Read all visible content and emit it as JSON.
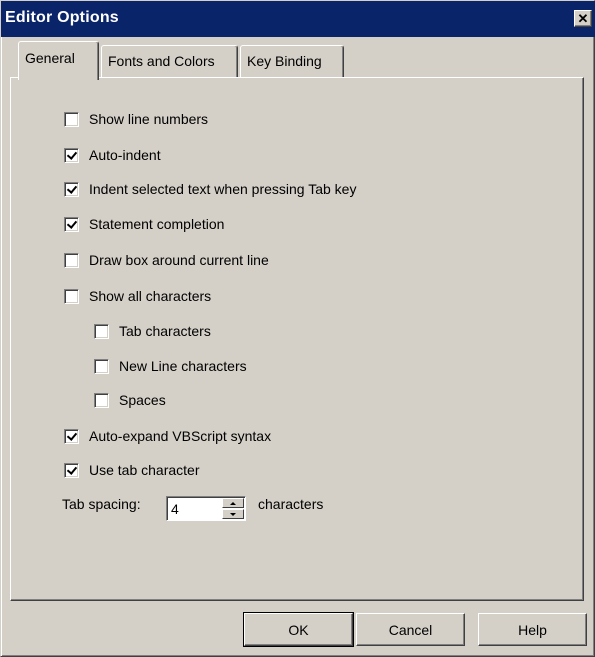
{
  "window": {
    "title": "Editor Options",
    "close_glyph": "✕"
  },
  "tabs": [
    {
      "label": "General",
      "active": true
    },
    {
      "label": "Fonts and Colors",
      "active": false
    },
    {
      "label": "Key Binding",
      "active": false
    }
  ],
  "options": [
    {
      "label": "Show line numbers",
      "checked": false
    },
    {
      "label": "Auto-indent",
      "checked": true
    },
    {
      "label": "Indent selected text when pressing Tab key",
      "checked": true
    },
    {
      "label": "Statement completion",
      "checked": true
    },
    {
      "label": "Draw box around current line",
      "checked": false
    },
    {
      "label": "Show all characters",
      "checked": false
    },
    {
      "label": "Tab characters",
      "checked": false
    },
    {
      "label": "New Line characters",
      "checked": false
    },
    {
      "label": "Spaces",
      "checked": false
    },
    {
      "label": "Auto-expand VBScript syntax",
      "checked": true
    },
    {
      "label": "Use tab character",
      "checked": true
    }
  ],
  "tab_spacing": {
    "label": "Tab spacing:",
    "value": "4",
    "unit_label": "characters"
  },
  "buttons": {
    "ok": "OK",
    "cancel": "Cancel",
    "help": "Help"
  },
  "icons": {
    "checkbox_check": "checkmark-icon",
    "spin_up": "arrow-up-icon",
    "spin_down": "arrow-down-icon"
  }
}
